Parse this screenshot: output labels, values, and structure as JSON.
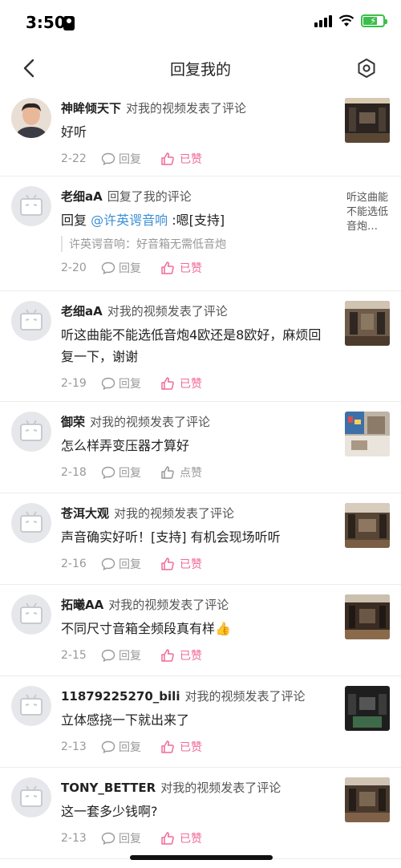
{
  "status": {
    "time": "3:50"
  },
  "nav": {
    "title": "回复我的"
  },
  "items": [
    {
      "user": "神眸倾天下",
      "action": "对我的视频发表了评论",
      "text": "好听",
      "date": "2-22",
      "reply": "回复",
      "like": "已赞",
      "liked": true,
      "avatar": "photo",
      "thumb": "image"
    },
    {
      "user": "老细aA",
      "action": "回复了我的评论",
      "pre": "回复 ",
      "mention": "@许英谔音响",
      "text": " :嗯[支持]",
      "quote": "许英谔音响：好音箱无需低音炮",
      "date": "2-20",
      "reply": "回复",
      "like": "已赞",
      "liked": true,
      "avatar": "default",
      "thumb_text": "听这曲能不能选低音炮…"
    },
    {
      "user": "老细aA",
      "action": "对我的视频发表了评论",
      "text": "听这曲能不能选低音炮4欧还是8欧好，麻烦回复一下，谢谢",
      "date": "2-19",
      "reply": "回复",
      "like": "已赞",
      "liked": true,
      "avatar": "default",
      "thumb": "image"
    },
    {
      "user": "御荣",
      "action": "对我的视频发表了评论",
      "text": "怎么样弄变压器才算好",
      "date": "2-18",
      "reply": "回复",
      "like": "点赞",
      "liked": false,
      "avatar": "default",
      "thumb": "image"
    },
    {
      "user": "苍洱大观",
      "action": "对我的视频发表了评论",
      "text": "声音确实好听！[支持] 有机会现场听听",
      "date": "2-16",
      "reply": "回复",
      "like": "已赞",
      "liked": true,
      "avatar": "default",
      "thumb": "image"
    },
    {
      "user": "拓曦AA",
      "action": "对我的视频发表了评论",
      "text": "不同尺寸音箱全频段真有样👍",
      "date": "2-15",
      "reply": "回复",
      "like": "已赞",
      "liked": true,
      "avatar": "default",
      "thumb": "image"
    },
    {
      "user": "11879225270_bili",
      "action": "对我的视频发表了评论",
      "text": "立体感挠一下就出来了",
      "date": "2-13",
      "reply": "回复",
      "like": "已赞",
      "liked": true,
      "avatar": "default",
      "thumb": "image"
    },
    {
      "user": "TONY_BETTER",
      "action": "对我的视频发表了评论",
      "text": "这一套多少钱啊?",
      "date": "2-13",
      "reply": "回复",
      "like": "已赞",
      "liked": true,
      "avatar": "default",
      "thumb": "image"
    }
  ],
  "colors": {
    "accent_pink": "#f06a96",
    "mention_blue": "#3a8fd6",
    "battery_green": "#3bbf4a"
  },
  "icons": {
    "back": "chevron-left-icon",
    "settings": "hexagon-gear-icon",
    "reply": "comment-bubble-icon",
    "like": "thumbs-up-icon"
  }
}
